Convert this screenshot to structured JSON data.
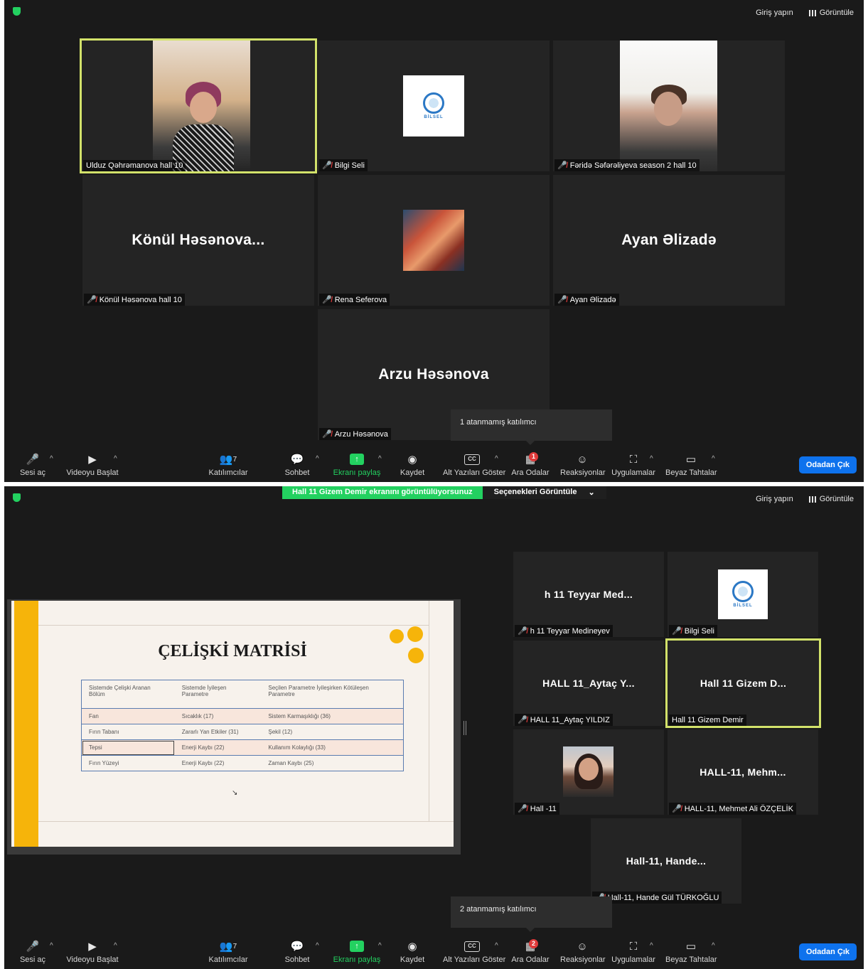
{
  "top": {
    "signin": "Giriş yapın",
    "view": "Görüntüle"
  },
  "screen1": {
    "tiles": {
      "ulduz": {
        "label": "Ulduz Qəhrəmanova hall 10"
      },
      "bilgi": {
        "label": "Bilgi Seli"
      },
      "ferida": {
        "label": "Fəridə Səfərəliyeva season 2 hall 10"
      },
      "konul": {
        "big": "Könül  Həsənova...",
        "label": "Könül Həsənova hall 10"
      },
      "rena": {
        "label": "Rena Seferova"
      },
      "ayan": {
        "big": "Ayan Əlizadə",
        "label": "Ayan Əlizadə"
      },
      "arzu": {
        "big": "Arzu Həsənova",
        "label": "Arzu Həsənova"
      }
    },
    "tooltip": "1 atanmamış katılımcı",
    "breakout_badge": "1"
  },
  "screen2": {
    "sharing_banner": "Hall 11 Gizem Demir ekranını görüntülüyorsunuz",
    "view_options": "Seçenekleri Görüntüle",
    "tiles": {
      "teyyar": {
        "big": "h 11 Teyyar Med...",
        "label": "h 11 Teyyar Medineyev"
      },
      "bilgi": {
        "label": "Bilgi Seli"
      },
      "aytac": {
        "big": "HALL 11_Aytaç Y...",
        "label": "HALL 11_Aytaç YILDIZ"
      },
      "gizem": {
        "big": "Hall 11 Gizem D...",
        "label": "Hall 11 Gizem Demir"
      },
      "hall11": {
        "label": "Hall -11"
      },
      "mehmet": {
        "big": "HALL-11,  Mehm...",
        "label": "HALL-11, Mehmet Ali ÖZÇELİK"
      },
      "hande": {
        "big": "Hall-11,  Hande...",
        "label": "Hall-11, Hande Gül TÜRKOĞLU"
      }
    },
    "tooltip": "2 atanmamış katılımcı",
    "breakout_badge": "2",
    "slide": {
      "title": "ÇELİŞKİ MATRİSİ",
      "headers": [
        "Sistemde Çelişki Aranan Bölüm",
        "Sistemde İyileşen Parametre",
        "Seçilen Parametre İyileşirken Kötüleşen Parametre"
      ],
      "rows": [
        [
          "Fan",
          "Sıcaklık (17)",
          "Sistem Karmaşıklığı (36)"
        ],
        [
          "Fırın Tabanı",
          "Zararlı Yan Etkiler (31)",
          "Şekil (12)"
        ],
        [
          "Tepsi",
          "Enerji Kaybı (22)",
          "Kullanım Kolaylığı (33)"
        ],
        [
          "Fırın Yüzeyi",
          "Enerji Kaybı (22)",
          "Zaman Kaybı (25)"
        ]
      ]
    }
  },
  "toolbar": {
    "unmute": "Sesi aç",
    "start_video": "Videoyu Başlat",
    "participants": "Katılımcılar",
    "participants_count": "7",
    "chat": "Sohbet",
    "share": "Ekranı paylaş",
    "record": "Kaydet",
    "captions": "Alt Yazıları Göster",
    "captions_icon": "CC",
    "breakout": "Ara Odalar",
    "reactions": "Reaksiyonlar",
    "apps": "Uygulamalar",
    "whiteboard": "Beyaz Tahtalar",
    "leave": "Odadan Çık"
  },
  "colors": {
    "active_border": "#d2e26a",
    "share_green": "#23d160",
    "leave_blue": "#0e72ed",
    "mute_red": "#e03a3a"
  },
  "logo_text": "BİLSEL"
}
